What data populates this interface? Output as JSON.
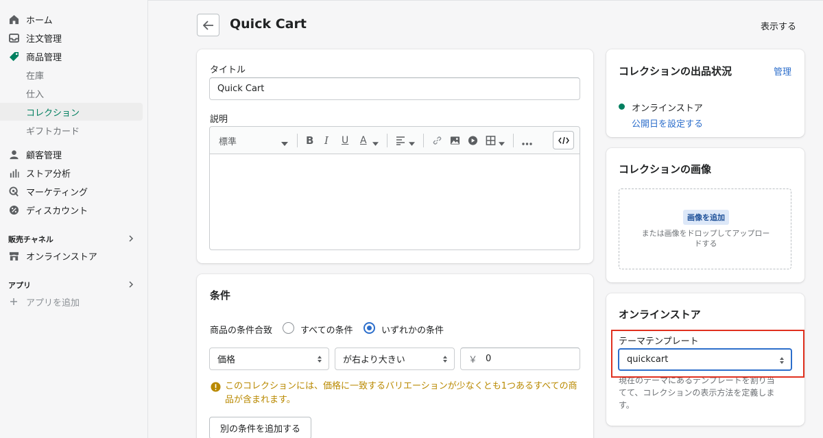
{
  "sidebar": {
    "items": [
      {
        "label": "ホーム",
        "icon": "home-icon"
      },
      {
        "label": "注文管理",
        "icon": "orders-icon"
      },
      {
        "label": "商品管理",
        "icon": "tag-icon"
      },
      {
        "label": "在庫"
      },
      {
        "label": "仕入"
      },
      {
        "label": "コレクション"
      },
      {
        "label": "ギフトカード"
      },
      {
        "label": "顧客管理",
        "icon": "customer-icon"
      },
      {
        "label": "ストア分析",
        "icon": "analytics-icon"
      },
      {
        "label": "マーケティング",
        "icon": "marketing-icon"
      },
      {
        "label": "ディスカウント",
        "icon": "discount-icon"
      }
    ],
    "sales_channels_label": "販売チャネル",
    "online_store_label": "オンラインストア",
    "apps_label": "アプリ",
    "add_app_label": "アプリを追加"
  },
  "header": {
    "title": "Quick Cart",
    "view_label": "表示する"
  },
  "main": {
    "title_label": "タイトル",
    "title_value": "Quick Cart",
    "description_label": "説明",
    "format_select": "標準",
    "conditions": {
      "title": "条件",
      "match_label": "商品の条件合致",
      "all_label": "すべての条件",
      "any_label": "いずれかの条件",
      "field": "価格",
      "operator": "が右より大きい",
      "currency": "￥",
      "value": "0",
      "warning_line1": "このコレクションには、価格に一致するバリエーションが少なくとも1つあるすべての商",
      "warning_line2": "品が含まれます。",
      "add_button": "別の条件を追加する"
    }
  },
  "right": {
    "availability": {
      "title": "コレクションの出品状況",
      "manage": "管理",
      "channel": "オンラインストア",
      "set_date": "公開日を設定する"
    },
    "image": {
      "title": "コレクションの画像",
      "add": "画像を追加",
      "hint_line1": "または画像をドロップしてアップロー",
      "hint_line2": "ドする"
    },
    "online_store": {
      "title": "オンラインストア",
      "template_label": "テーマテンプレート",
      "template_value": "quickcart",
      "help_line1": "現在のテーマにあるテンプレートを割り当",
      "help_line2": "てて、コレクションの表示方法を定義しま",
      "help_line3": "す。"
    }
  },
  "colors": {
    "accent_green": "#007f5f",
    "link_blue": "#2c6ecb",
    "warning": "#b98900",
    "highlight_red": "#e0301e"
  }
}
